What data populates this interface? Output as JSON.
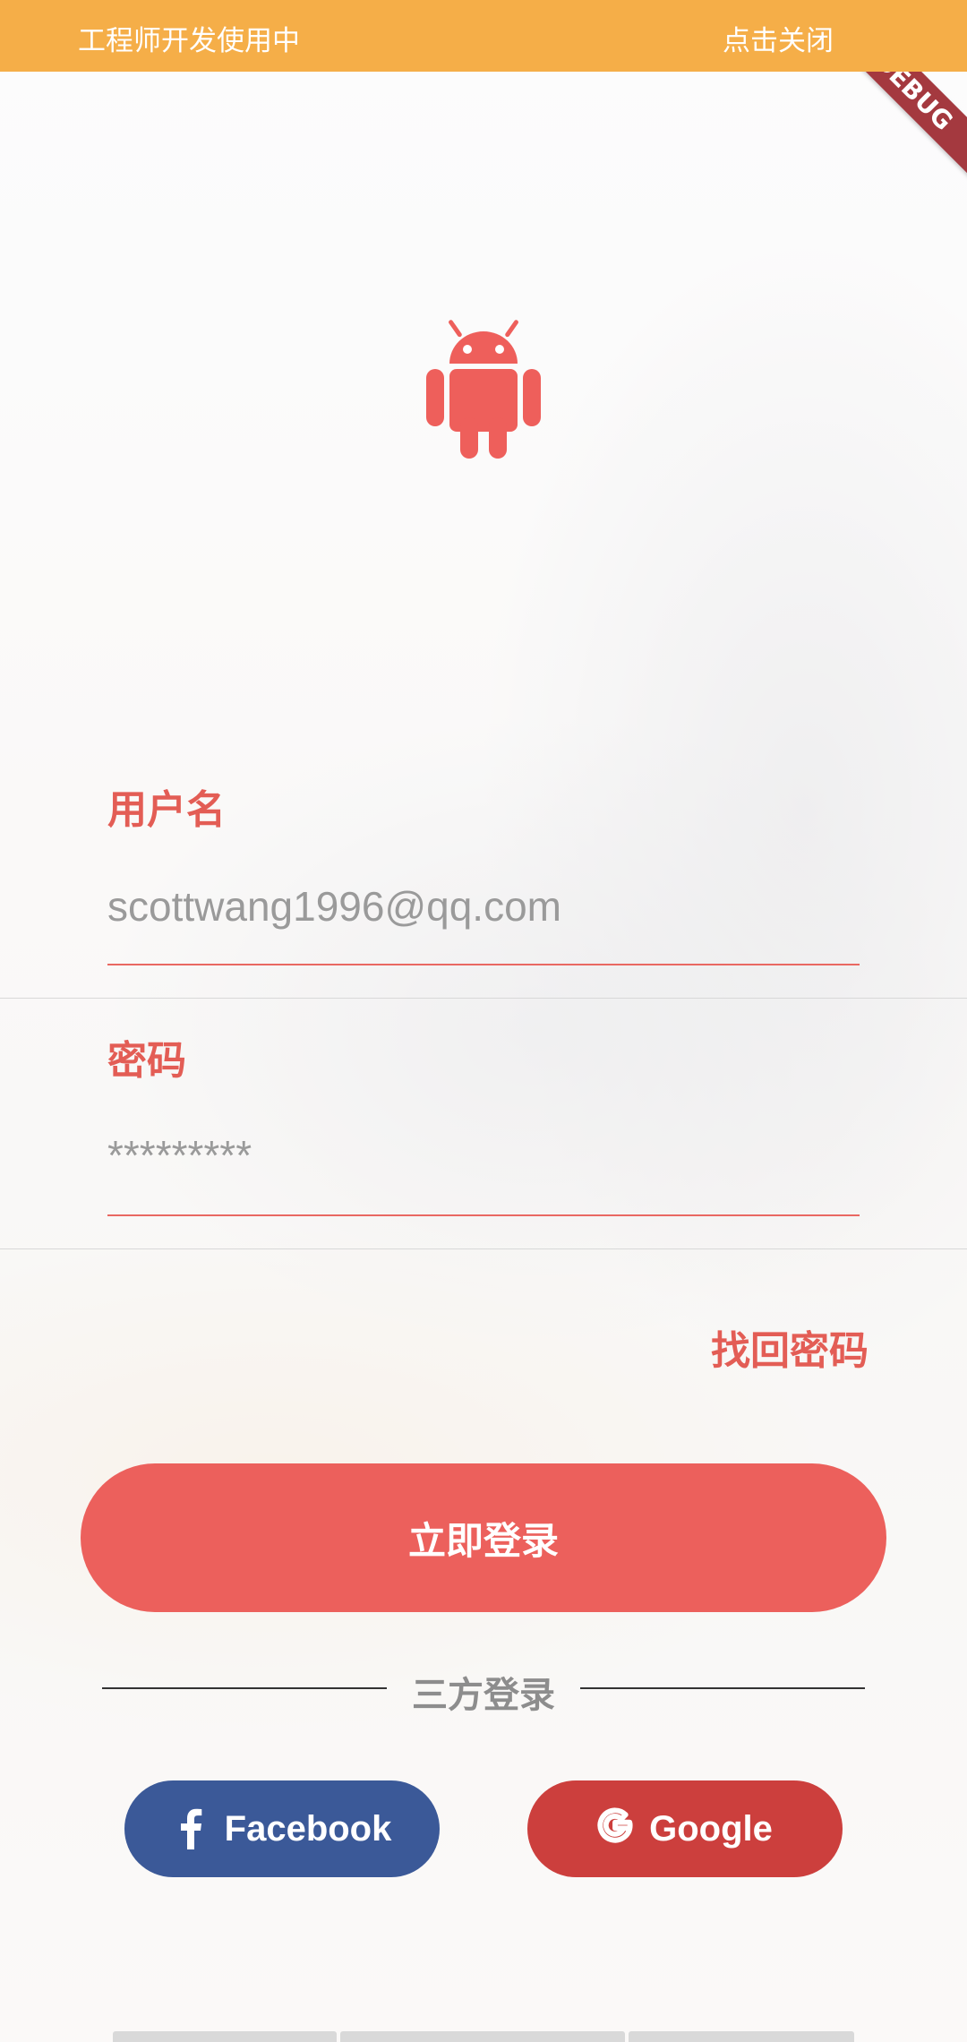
{
  "dev_banner": {
    "left_text": "工程师开发使用中",
    "right_text": "点击关闭"
  },
  "debug_ribbon": {
    "text": "DEBUG"
  },
  "logo": {
    "icon": "android-icon",
    "color": "#ee5f5b"
  },
  "form": {
    "username": {
      "label": "用户名",
      "placeholder": "scottwang1996@qq.com",
      "value": ""
    },
    "password": {
      "label": "密码",
      "placeholder": "*********",
      "value": ""
    },
    "forgot_password": "找回密码"
  },
  "login_button": {
    "label": "立即登录"
  },
  "third_party": {
    "label": "三方登录",
    "buttons": [
      {
        "label": "Facebook",
        "icon": "facebook-icon",
        "color": "#3b5998"
      },
      {
        "label": "Google",
        "icon": "google-icon",
        "color": "#cc3f3d"
      }
    ]
  },
  "colors": {
    "accent": "#ec605c",
    "banner": "#f5ae48",
    "ribbon": "#a4393f"
  }
}
